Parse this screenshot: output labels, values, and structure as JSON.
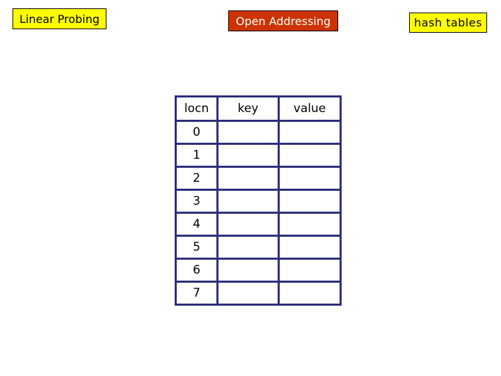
{
  "labels": {
    "topic": "Linear Probing",
    "title": "Open Addressing",
    "section": "hash tables"
  },
  "colors": {
    "yellow": "#ffff00",
    "title_bg": "#cc3300",
    "table_border": "#2e2e7a"
  },
  "table": {
    "headers": [
      "locn",
      "key",
      "value"
    ],
    "rows": [
      {
        "locn": "0",
        "key": "",
        "value": ""
      },
      {
        "locn": "1",
        "key": "",
        "value": ""
      },
      {
        "locn": "2",
        "key": "",
        "value": ""
      },
      {
        "locn": "3",
        "key": "",
        "value": ""
      },
      {
        "locn": "4",
        "key": "",
        "value": ""
      },
      {
        "locn": "5",
        "key": "",
        "value": ""
      },
      {
        "locn": "6",
        "key": "",
        "value": ""
      },
      {
        "locn": "7",
        "key": "",
        "value": ""
      }
    ]
  }
}
